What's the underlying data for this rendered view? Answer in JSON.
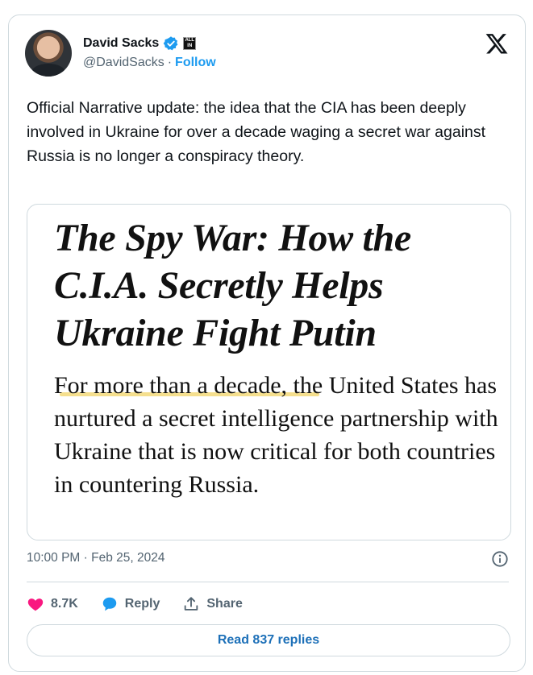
{
  "author": {
    "name": "David Sacks",
    "handle": "@DavidSacks",
    "separator": "·",
    "follow_label": "Follow",
    "verified": true,
    "org_badge_text": [
      "ALL",
      "IN"
    ]
  },
  "tweet": {
    "text": "Official Narrative update: the idea that the CIA has been deeply involved in Ukraine for over a decade waging a secret war against Russia is no longer a conspiracy theory."
  },
  "media": {
    "headline": "The Spy War: How the C.I.A. Secretly Helps Ukraine Fight Putin",
    "lede": "For more than a decade, the United States has nurtured a secret intelligence partnership with Ukraine that is now critical for both countries in countering Russia."
  },
  "meta": {
    "timestamp": "10:00 PM · Feb 25, 2024"
  },
  "actions": {
    "likes": "8.7K",
    "reply_label": "Reply",
    "share_label": "Share"
  },
  "read_replies_label": "Read 837 replies",
  "colors": {
    "accent": "#1d9bf0",
    "like": "#f91880",
    "muted": "#536471",
    "border": "#cfd9de",
    "highlight": "#f3d97a"
  },
  "icons": [
    "verified-badge-icon",
    "x-logo-icon",
    "info-icon",
    "heart-icon",
    "reply-bubble-icon",
    "share-icon"
  ]
}
